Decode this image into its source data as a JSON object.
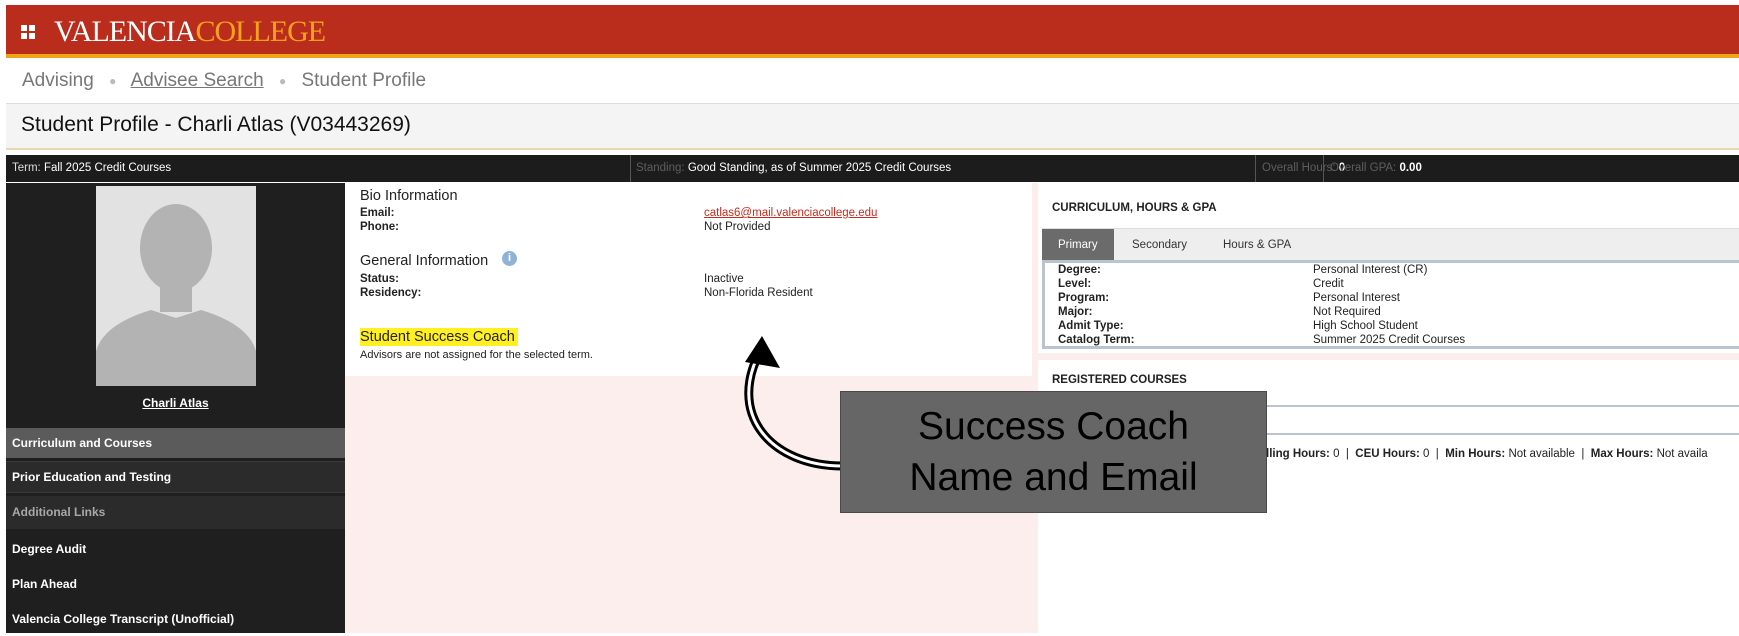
{
  "header": {
    "logo_part1": "VALENCIA",
    "logo_part2": "COLLEGE",
    "brand_color": "#ba2c1c",
    "accent_color": "#f0a418"
  },
  "breadcrumb": {
    "items": [
      "Advising",
      "Advisee Search",
      "Student Profile"
    ]
  },
  "page_title": "Student Profile - Charli Atlas (V03443269)",
  "infobar": {
    "term_label": "Term:",
    "term_value": "Fall 2025 Credit Courses",
    "standing_label": "Standing:",
    "standing_value": "Good Standing, as of Summer 2025 Credit Courses",
    "overall_hours_label": "Overall Hours:",
    "overall_hours_value": "0",
    "overall_gpa_label": "Overall GPA:",
    "overall_gpa_value": "0.00"
  },
  "sidebar": {
    "student_name": "Charli Atlas",
    "items": [
      "Curriculum and Courses",
      "Prior Education and Testing",
      "Additional Links",
      "Degree Audit",
      "Plan Ahead",
      "Valencia College Transcript (Unofficial)"
    ]
  },
  "bio": {
    "title": "Bio Information",
    "email_label": "Email:",
    "email_value": "catlas6@mail.valenciacollege.edu",
    "phone_label": "Phone:",
    "phone_value": "Not Provided",
    "general_title": "General Information",
    "status_label": "Status:",
    "status_value": "Inactive",
    "residency_label": "Residency:",
    "residency_value": "Non-Florida Resident",
    "coach_title": "Student Success Coach",
    "coach_note": "Advisors are not assigned for the selected term."
  },
  "curriculum": {
    "title": "CURRICULUM, HOURS & GPA",
    "tabs": [
      "Primary",
      "Secondary",
      "Hours & GPA"
    ],
    "rows": [
      {
        "label": "Degree:",
        "value": "Personal Interest (CR)"
      },
      {
        "label": "Level:",
        "value": "Credit"
      },
      {
        "label": "Program:",
        "value": "Personal Interest"
      },
      {
        "label": "Major:",
        "value": "Not Required"
      },
      {
        "label": "Admit Type:",
        "value": "High School Student"
      },
      {
        "label": "Catalog Term:",
        "value": "Summer 2025 Credit Courses"
      }
    ]
  },
  "registered": {
    "title": "REGISTERED COURSES",
    "billing_label": "lling Hours:",
    "billing_value": "0",
    "ceu_label": "CEU Hours:",
    "ceu_value": "0",
    "min_label": "Min Hours:",
    "min_value": "Not available",
    "max_label": "Max Hours:",
    "max_value": "Not availa"
  },
  "callout": {
    "line1": "Success Coach",
    "line2": "Name and Email"
  }
}
